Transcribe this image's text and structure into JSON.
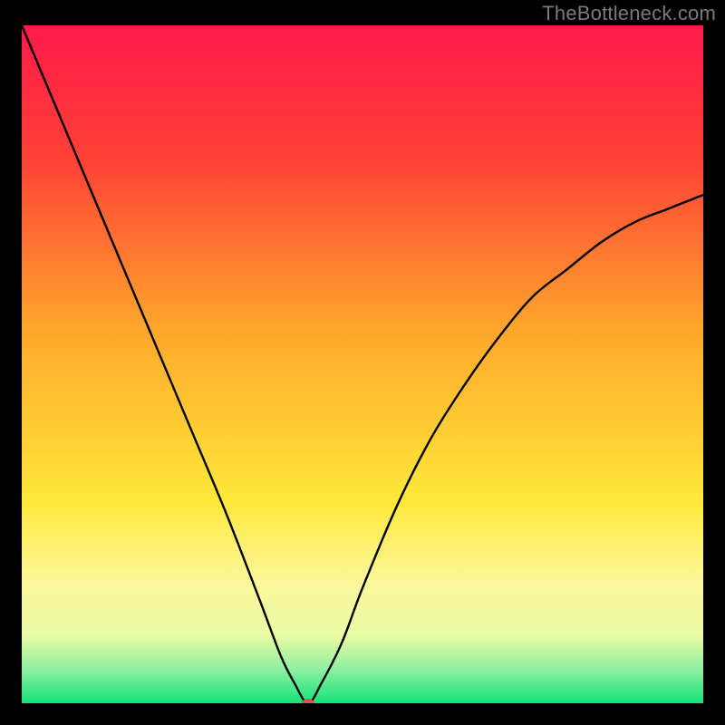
{
  "watermark": "TheBottleneck.com",
  "chart_data": {
    "type": "line",
    "title": "",
    "xlabel": "",
    "ylabel": "",
    "xlim": [
      0,
      100
    ],
    "ylim": [
      0,
      100
    ],
    "background_gradient": {
      "stops": [
        {
          "offset": 0.0,
          "color": "#ff1a4b"
        },
        {
          "offset": 0.2,
          "color": "#ff4236"
        },
        {
          "offset": 0.45,
          "color": "#ffa72c"
        },
        {
          "offset": 0.7,
          "color": "#ffe83a"
        },
        {
          "offset": 0.82,
          "color": "#fdf79a"
        },
        {
          "offset": 0.9,
          "color": "#e9fca6"
        },
        {
          "offset": 0.95,
          "color": "#8ff0a0"
        },
        {
          "offset": 1.0,
          "color": "#15e27a"
        }
      ]
    },
    "curve": {
      "description": "V-shaped bottleneck curve; y is severity (0 best, 100 worst), minimum ≈ x=42",
      "x": [
        0,
        5,
        10,
        15,
        20,
        25,
        30,
        35,
        38,
        40,
        42,
        44,
        47,
        50,
        55,
        60,
        65,
        70,
        75,
        80,
        85,
        90,
        95,
        100
      ],
      "y": [
        100,
        88,
        76,
        64,
        52,
        40,
        28,
        15,
        7,
        3,
        0,
        3,
        9,
        17,
        29,
        39,
        47,
        54,
        60,
        64,
        68,
        71,
        73,
        75
      ]
    },
    "marker": {
      "x": 42,
      "y": 0,
      "color": "#c65a53",
      "rx": 7,
      "ry": 5
    }
  }
}
